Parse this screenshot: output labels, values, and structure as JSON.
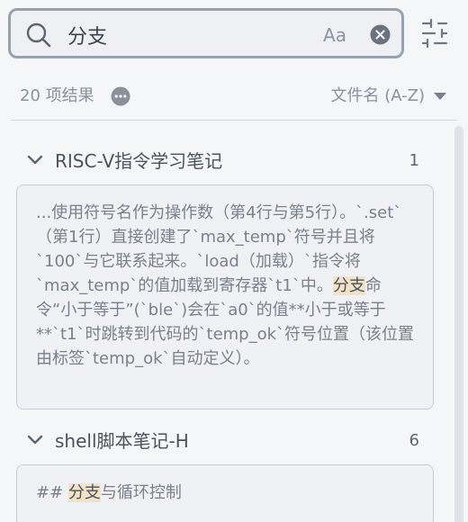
{
  "search": {
    "query": "分支",
    "match_case_label": "Aa"
  },
  "results": {
    "count_label": "20 项结果",
    "sort_label": "文件名 (A-Z)"
  },
  "groups": [
    {
      "title": "RISC-V指令学习笔记",
      "count": "1",
      "snippet_before": "...使用符号名作为操作数（第4行与第5行）。`.set`（第1行）直接创建了`max_temp`符号并且将`100`与它联系起来。`load（加载）`指令将`max_temp`的值加载到寄存器`t1`中。",
      "snippet_match": "分支",
      "snippet_after": "命令“小于等于”(`ble`)会在`a0`的值**小于或等于**`t1`时跳转到代码的`temp_ok`符号位置（该位置由标签`temp_ok`自动定义）。"
    },
    {
      "title": "shell脚本笔记-H",
      "count": "6",
      "snippet_before": "## ",
      "snippet_match": "分支",
      "snippet_after": "与循环控制"
    }
  ],
  "colors": {
    "highlight": "#f2e3c8",
    "border": "#9aa1ae"
  },
  "icons": [
    "search-icon",
    "match-case-icon",
    "clear-icon",
    "filter-settings-icon",
    "more-options-icon",
    "sort-caret-icon",
    "chevron-down-icon"
  ]
}
